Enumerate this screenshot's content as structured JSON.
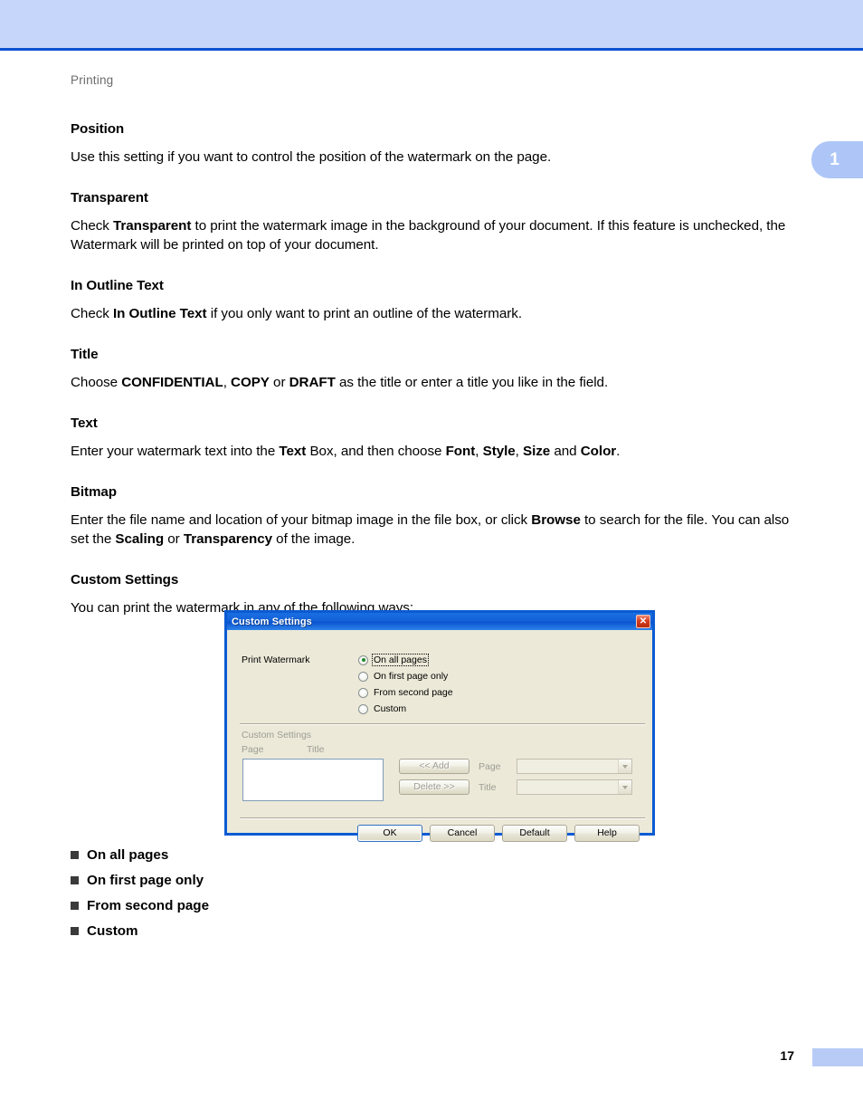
{
  "page": {
    "running_head": "Printing",
    "chapter_number": "1",
    "page_number": "17",
    "header_band_color": "#c6d6fb",
    "header_rule_color": "#0b50d0",
    "chapter_tab_color": "#aec6f7"
  },
  "sections": [
    {
      "heading": "Position",
      "body_html": "Use this setting if you want to control the position of the watermark on the page."
    },
    {
      "heading": "Transparent",
      "body_html": "Check <b>Transparent</b> to print the watermark image in the background of your document. If this feature is unchecked, the Watermark will be printed on top of your document."
    },
    {
      "heading": "In Outline Text",
      "body_html": "Check <b>In Outline Text</b> if you only want to print an outline of the watermark."
    },
    {
      "heading": "Title",
      "body_html": "Choose <b>CONFIDENTIAL</b>, <b>COPY</b> or <b>DRAFT</b> as the title or enter a title you like in the field."
    },
    {
      "heading": "Text",
      "body_html": "Enter your watermark text into the <b>Text</b> Box, and then choose <b>Font</b>, <b>Style</b>, <b>Size</b> and <b>Color</b>."
    },
    {
      "heading": "Bitmap",
      "body_html": "Enter the file name and location of your bitmap image in the file box, or click <b>Browse</b> to search for the file. You can also set the <b>Scaling</b> or <b>Transparency</b> of the image."
    },
    {
      "heading": "Custom Settings",
      "body_html": "You can print the watermark in any of the following ways:"
    }
  ],
  "bullets": [
    "On all pages",
    "On first page only",
    "From second page",
    "Custom"
  ],
  "dialog": {
    "title": "Custom Settings",
    "close_icon": "close-icon",
    "print_watermark_label": "Print Watermark",
    "radio_options": [
      {
        "label": "On all pages",
        "accel": "O",
        "selected": true,
        "focused": true
      },
      {
        "label": "On first page only",
        "accel": "f",
        "selected": false,
        "focused": false
      },
      {
        "label": "From second page",
        "accel": "s",
        "selected": false,
        "focused": false
      },
      {
        "label": "Custom",
        "accel": "C",
        "selected": false,
        "focused": false
      }
    ],
    "group_label": "Custom Settings",
    "column_headers": {
      "page": "Page",
      "title": "Title"
    },
    "list_items": [],
    "add_button": "<< Add",
    "delete_button": "Delete >>",
    "page_field_label": "Page",
    "title_field_label": "Title",
    "page_field_value": "",
    "title_field_value": "",
    "buttons": [
      {
        "label": "OK",
        "default": true
      },
      {
        "label": "Cancel",
        "default": false
      },
      {
        "label": "Default",
        "default": false
      },
      {
        "label": "Help",
        "default": false
      }
    ],
    "titlebar_color": "#0a52cf",
    "face_color": "#ece9d8",
    "close_color": "#d83d1d"
  }
}
